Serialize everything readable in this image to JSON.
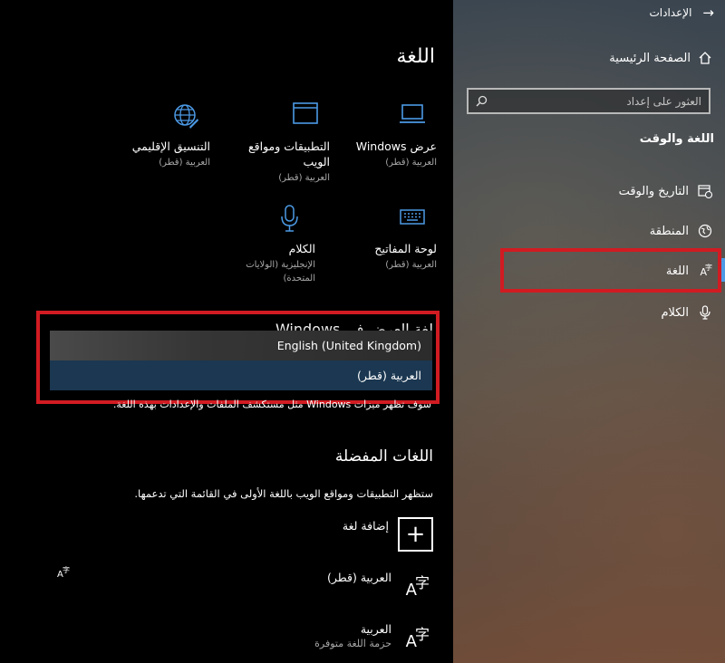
{
  "nav": {
    "title": "الإعدادات",
    "home": "الصفحة الرئيسية",
    "search_placeholder": "العثور على إعداد",
    "section": "اللغة والوقت",
    "items": [
      {
        "label": "التاريخ والوقت",
        "icon": "calendar-clock-icon"
      },
      {
        "label": "المنطقة",
        "icon": "globe-region-icon"
      },
      {
        "label": "اللغة",
        "icon": "language-icon",
        "selected": true
      },
      {
        "label": "الكلام",
        "icon": "microphone-icon"
      }
    ]
  },
  "main": {
    "title": "اللغة",
    "tiles": [
      {
        "title": "عرض Windows",
        "sub": "العربية (قطر)",
        "icon": "display-icon"
      },
      {
        "title": "التطبيقات ومواقع الويب",
        "sub": "العربية (قطر)",
        "icon": "browser-window-icon"
      },
      {
        "title": "التنسيق الإقليمي",
        "sub": "العربية (قطر)",
        "icon": "globe-format-icon"
      },
      {
        "title": "لوحة المفاتيح",
        "sub": "العربية (قطر)",
        "icon": "keyboard-icon"
      },
      {
        "title": "الكلام",
        "sub": "الإنجليزية (الولايات المتحدة)",
        "icon": "microphone-icon"
      }
    ],
    "hidden_heading": "لغة العرض في Windows",
    "dropdown": {
      "options": [
        "English (United Kingdom)",
        "العربية (قطر)"
      ],
      "selected": "العربية (قطر)"
    },
    "dropdown_note": "سوف تظهر ميزات Windows مثل مستكشف الملفات والإعدادات بهذه اللغة.",
    "preferred": {
      "heading": "اللغات المفضلة",
      "desc": "ستظهر التطبيقات ومواقع الويب باللغة الأولى في القائمة التي تدعمها.",
      "add_label": "إضافة لغة",
      "languages": [
        {
          "name": "العربية (قطر)",
          "sub": ""
        },
        {
          "name": "العربية",
          "sub": "حزمة اللغة متوفرة"
        }
      ]
    }
  },
  "colors": {
    "highlight": "#d11b22",
    "selected_option": "#1b3751",
    "accent": "#4c9ae6"
  }
}
